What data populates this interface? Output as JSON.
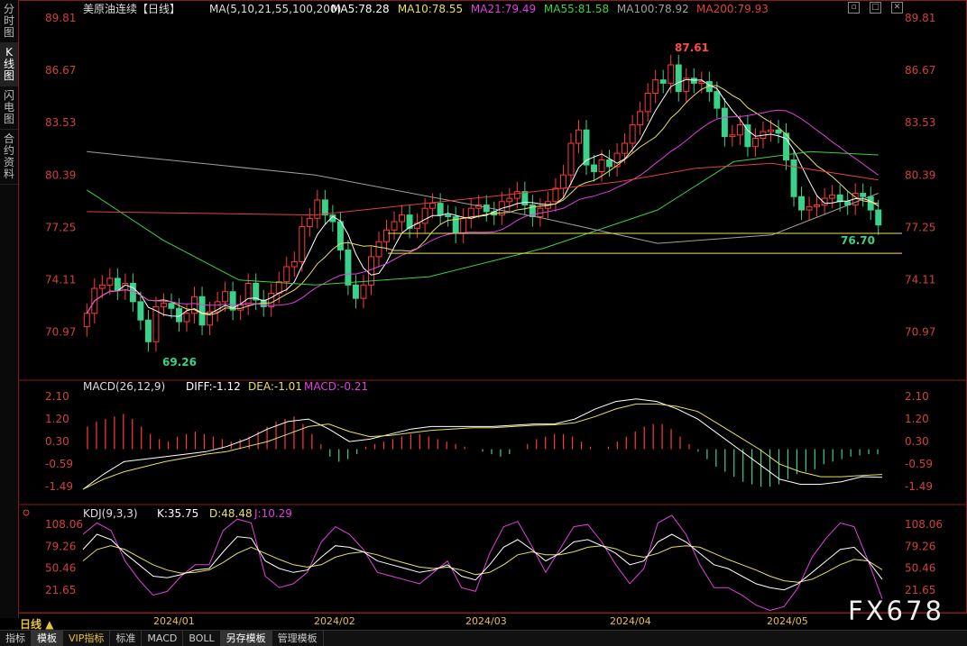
{
  "sidebar": {
    "tabs": [
      "分时图",
      "K线图",
      "闪电图",
      "合约资料"
    ],
    "active": 1
  },
  "header": {
    "title": "美原油连续【日线】",
    "ma_label": "MA(5,10,21,55,100,200)",
    "mas": [
      {
        "label": "MA5:78.28",
        "color": "#ffffff"
      },
      {
        "label": "MA10:78.55",
        "color": "#e8e060"
      },
      {
        "label": "MA21:79.49",
        "color": "#e040e0"
      },
      {
        "label": "MA55:81.58",
        "color": "#40d040"
      },
      {
        "label": "MA100:78.92",
        "color": "#a0a0a0"
      },
      {
        "label": "MA200:79.93",
        "color": "#e04040"
      }
    ]
  },
  "macd_header": {
    "title": "MACD(26,12,9)",
    "diff": "DIFF:-1.12",
    "dea": "DEA:-1.01",
    "macd": "MACD:-0.21"
  },
  "kdj_header": {
    "title": "KDJ(9,3,3)",
    "k": "K:35.75",
    "d": "D:48.48",
    "j": "J:10.29"
  },
  "chart_data": {
    "type": "candlestick",
    "price_ticks": [
      89.81,
      86.67,
      83.53,
      80.39,
      77.25,
      74.11,
      70.97
    ],
    "macd_ticks": [
      2.1,
      1.2,
      0.3,
      -0.59,
      -1.49
    ],
    "kdj_ticks": [
      108.06,
      79.26,
      50.46,
      21.65
    ],
    "x_labels": [
      "2024/01",
      "2024/02",
      "2024/03",
      "2024/04",
      "2024/05"
    ],
    "annotations": {
      "high": "87.61",
      "low1": "69.26",
      "low2": "76.70"
    },
    "horizontal_lines": [
      76.9,
      75.7
    ],
    "closes": [
      72.1,
      73.6,
      73.8,
      74.2,
      73.5,
      73.9,
      72.8,
      71.7,
      70.4,
      72.5,
      72.7,
      72.4,
      71.6,
      72.1,
      73.1,
      71.4,
      72.2,
      72.8,
      73.4,
      72.3,
      72.6,
      73.9,
      72.9,
      72.5,
      73.3,
      74.0,
      74.9,
      75.2,
      77.3,
      77.8,
      78.9,
      78.0,
      77.6,
      75.9,
      73.8,
      73.0,
      73.8,
      75.5,
      76.4,
      77.1,
      77.6,
      78.0,
      77.2,
      77.5,
      78.4,
      78.7,
      78.0,
      77.9,
      76.9,
      77.8,
      78.4,
      78.6,
      78.2,
      78.0,
      78.8,
      79.0,
      79.4,
      78.6,
      77.9,
      78.4,
      78.8,
      79.6,
      80.4,
      82.3,
      83.1,
      81.0,
      80.6,
      81.3,
      80.9,
      81.7,
      82.3,
      83.4,
      84.2,
      85.3,
      86.1,
      85.9,
      87.0,
      85.4,
      86.2,
      85.9,
      86.0,
      85.4,
      84.4,
      82.7,
      82.8,
      83.4,
      82.1,
      82.6,
      83.0,
      83.1,
      82.9,
      81.3,
      79.1,
      78.3,
      78.5,
      78.6,
      79.0,
      79.2,
      78.8,
      78.6,
      79.3,
      79.1,
      78.3,
      77.4
    ],
    "ma_keys": [
      "ma5",
      "ma10",
      "ma21",
      "ma55",
      "ma100",
      "ma200"
    ],
    "ma100_pts": [
      [
        0,
        81.8
      ],
      [
        30,
        80.4
      ],
      [
        60,
        77.8
      ],
      [
        75,
        76.3
      ],
      [
        90,
        76.8
      ],
      [
        104,
        79.3
      ]
    ],
    "ma200_pts": [
      [
        0,
        78.2
      ],
      [
        30,
        78.0
      ],
      [
        55,
        79.2
      ],
      [
        70,
        80.0
      ],
      [
        80,
        80.8
      ],
      [
        90,
        81.1
      ],
      [
        104,
        80.1
      ]
    ],
    "ma55_pts": [
      [
        0,
        79.5
      ],
      [
        10,
        76.5
      ],
      [
        20,
        74.1
      ],
      [
        30,
        73.8
      ],
      [
        45,
        74.3
      ],
      [
        60,
        76.0
      ],
      [
        75,
        78.3
      ],
      [
        85,
        81.2
      ],
      [
        95,
        81.8
      ],
      [
        104,
        81.6
      ]
    ],
    "macd_hist": [
      0.9,
      1.1,
      1.2,
      1.3,
      1.4,
      1.2,
      0.9,
      0.6,
      0.4,
      0.3,
      0.5,
      0.6,
      0.7,
      0.6,
      0.5,
      0.4,
      0.3,
      0.4,
      0.5,
      0.7,
      0.9,
      1.1,
      1.2,
      1.3,
      1.0,
      0.6,
      0.2,
      -0.3,
      -0.5,
      -0.4,
      -0.2,
      0.1,
      0.2,
      0.3,
      0.4,
      0.5,
      0.6,
      0.6,
      0.5,
      0.4,
      0.3,
      0.2,
      0.1,
      0.0,
      -0.1,
      -0.2,
      -0.3,
      -0.2,
      0.0,
      0.2,
      0.4,
      0.5,
      0.6,
      0.6,
      0.5,
      0.3,
      0.1,
      0.0,
      0.1,
      0.3,
      0.5,
      0.7,
      0.9,
      1.0,
      1.0,
      0.8,
      0.5,
      0.2,
      -0.1,
      -0.4,
      -0.7,
      -0.9,
      -1.1,
      -1.3,
      -1.4,
      -1.5,
      -1.5,
      -1.4,
      -1.2,
      -1.0,
      -0.9,
      -0.8,
      -0.6,
      -0.5,
      -0.4,
      -0.3,
      -0.25,
      -0.2,
      -0.21
    ],
    "macd_diff": [
      -1.6,
      -1.0,
      -0.5,
      -0.4,
      -0.3,
      -0.2,
      -0.1,
      0.1,
      0.4,
      0.8,
      1.1,
      1.2,
      0.8,
      0.3,
      0.4,
      0.6,
      0.8,
      0.9,
      0.9,
      0.9,
      0.9,
      0.95,
      1.0,
      1.0,
      1.2,
      1.6,
      1.9,
      2.0,
      1.9,
      1.6,
      1.2,
      0.6,
      0.0,
      -0.6,
      -1.2,
      -1.4,
      -1.4,
      -1.3,
      -1.1,
      -1.12
    ],
    "macd_dea": [
      -1.6,
      -1.2,
      -0.9,
      -0.7,
      -0.5,
      -0.35,
      -0.2,
      -0.1,
      0.1,
      0.3,
      0.6,
      0.9,
      1.0,
      0.7,
      0.5,
      0.55,
      0.65,
      0.75,
      0.8,
      0.85,
      0.85,
      0.9,
      0.95,
      0.97,
      1.05,
      1.3,
      1.6,
      1.8,
      1.8,
      1.7,
      1.5,
      1.0,
      0.5,
      0.0,
      -0.6,
      -0.9,
      -1.1,
      -1.1,
      -1.05,
      -1.01
    ],
    "kdj_k": [
      75,
      95,
      88,
      70,
      55,
      40,
      38,
      42,
      48,
      50,
      72,
      92,
      90,
      60,
      50,
      45,
      48,
      65,
      80,
      78,
      72,
      60,
      55,
      50,
      45,
      48,
      55,
      40,
      35,
      55,
      78,
      88,
      75,
      60,
      70,
      85,
      88,
      80,
      70,
      55,
      60,
      85,
      95,
      85,
      70,
      55,
      50,
      40,
      30,
      25,
      22,
      30,
      45,
      60,
      75,
      78,
      60,
      35.75
    ],
    "kdj_d": [
      60,
      75,
      80,
      75,
      65,
      55,
      48,
      44,
      45,
      48,
      58,
      70,
      78,
      70,
      62,
      55,
      52,
      55,
      65,
      70,
      72,
      68,
      62,
      57,
      52,
      50,
      52,
      48,
      42,
      45,
      55,
      68,
      72,
      68,
      68,
      72,
      78,
      80,
      76,
      68,
      65,
      70,
      78,
      80,
      78,
      70,
      62,
      55,
      48,
      40,
      34,
      32,
      36,
      45,
      55,
      62,
      60,
      48.48
    ],
    "kdj_j": [
      95,
      110,
      100,
      60,
      35,
      15,
      20,
      40,
      55,
      55,
      100,
      115,
      110,
      40,
      25,
      30,
      45,
      85,
      105,
      95,
      75,
      45,
      40,
      35,
      30,
      45,
      60,
      25,
      20,
      70,
      105,
      112,
      80,
      45,
      75,
      105,
      108,
      85,
      55,
      30,
      50,
      110,
      120,
      95,
      55,
      25,
      25,
      15,
      2,
      -5,
      0,
      25,
      65,
      90,
      110,
      105,
      60,
      10.29
    ],
    "period": "日线"
  },
  "bottom_tabs": [
    "指标",
    "模板",
    "VIP指标",
    "标准",
    "MACD",
    "BOLL",
    "另存模板",
    "管理模板"
  ],
  "watermark": "FX678"
}
